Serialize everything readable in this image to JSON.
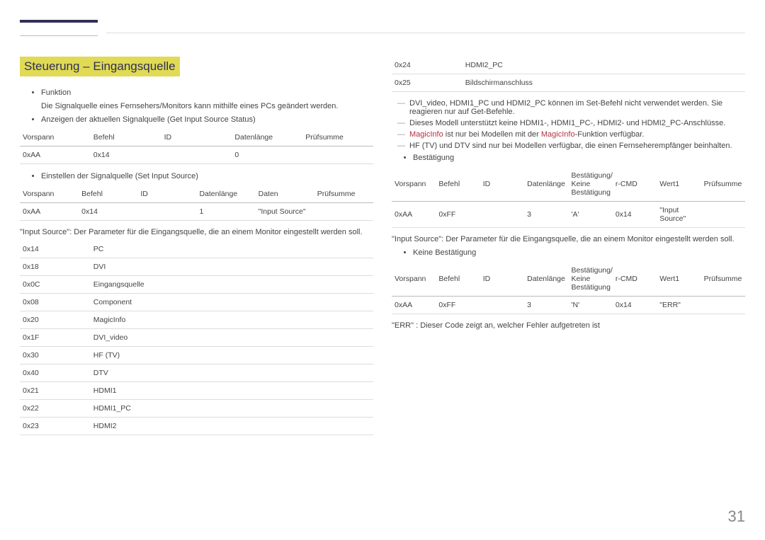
{
  "page_number": "31",
  "left": {
    "title": "Steuerung – Eingangsquelle",
    "funktion_label": "Funktion",
    "funktion_text": "Die Signalquelle eines Fernsehers/Monitors kann mithilfe eines PCs geändert werden.",
    "get_label": "Anzeigen der aktuellen Signalquelle (Get Input Source Status)",
    "get_table": {
      "headers": [
        "Vorspann",
        "Befehl",
        "ID",
        "Datenlänge",
        "Prüfsumme"
      ],
      "row": [
        "0xAA",
        "0x14",
        "",
        "0",
        ""
      ]
    },
    "set_label": "Einstellen der Signalquelle  (Set Input Source)",
    "set_table": {
      "headers": [
        "Vorspann",
        "Befehl",
        "ID",
        "Datenlänge",
        "Daten",
        "Prüfsumme"
      ],
      "row": [
        "0xAA",
        "0x14",
        "",
        "1",
        "\"Input Source\"",
        ""
      ]
    },
    "input_source_explain": "\"Input Source\": Der Parameter für die Eingangsquelle, die an einem Monitor eingestellt werden soll.",
    "sources": [
      {
        "code": "0x14",
        "name": "PC"
      },
      {
        "code": "0x18",
        "name": "DVI"
      },
      {
        "code": "0x0C",
        "name": "Eingangsquelle"
      },
      {
        "code": "0x08",
        "name": "Component"
      },
      {
        "code": "0x20",
        "name": "MagicInfo"
      },
      {
        "code": "0x1F",
        "name": "DVI_video"
      },
      {
        "code": "0x30",
        "name": "HF (TV)"
      },
      {
        "code": "0x40",
        "name": "DTV"
      },
      {
        "code": "0x21",
        "name": "HDMI1"
      },
      {
        "code": "0x22",
        "name": "HDMI1_PC"
      },
      {
        "code": "0x23",
        "name": "HDMI2"
      }
    ]
  },
  "right": {
    "sources_cont": [
      {
        "code": "0x24",
        "name": "HDMI2_PC"
      },
      {
        "code": "0x25",
        "name": "Bildschirmanschluss"
      }
    ],
    "notes": [
      "DVI_video, HDMI1_PC und HDMI2_PC können im Set-Befehl nicht verwendet werden. Sie reagieren nur auf Get-Befehle.",
      "Dieses Modell unterstützt keine HDMI1-, HDMI1_PC-, HDMI2- und HDMI2_PC-Anschlüsse."
    ],
    "magic_note_a": "MagicInfo",
    "magic_note_mid": " ist nur bei Modellen mit der ",
    "magic_note_b": "MagicInfo",
    "magic_note_end": "-Funktion verfügbar.",
    "note_hf": "HF (TV) und DTV sind nur bei Modellen verfügbar, die einen Fernseherempfänger beinhalten.",
    "ack_label": "Bestätigung",
    "ack_table": {
      "headers": [
        "Vorspann",
        "Befehl",
        "ID",
        "Datenlänge",
        "Bestätigung/ Keine Bestätigung",
        "r-CMD",
        "Wert1",
        "Prüfsumme"
      ],
      "row": [
        "0xAA",
        "0xFF",
        "",
        "3",
        "'A'",
        "0x14",
        "\"Input Source\"",
        ""
      ]
    },
    "input_source_explain": "\"Input Source\": Der Parameter für die Eingangsquelle, die an einem Monitor eingestellt werden soll.",
    "nak_label": "Keine Bestätigung",
    "nak_table": {
      "headers": [
        "Vorspann",
        "Befehl",
        "ID",
        "Datenlänge",
        "Bestätigung/ Keine Bestätigung",
        "r-CMD",
        "Wert1",
        "Prüfsumme"
      ],
      "row": [
        "0xAA",
        "0xFF",
        "",
        "3",
        "'N'",
        "0x14",
        "\"ERR\"",
        ""
      ]
    },
    "err_explain": "\"ERR\" : Dieser Code zeigt an, welcher Fehler aufgetreten ist"
  }
}
